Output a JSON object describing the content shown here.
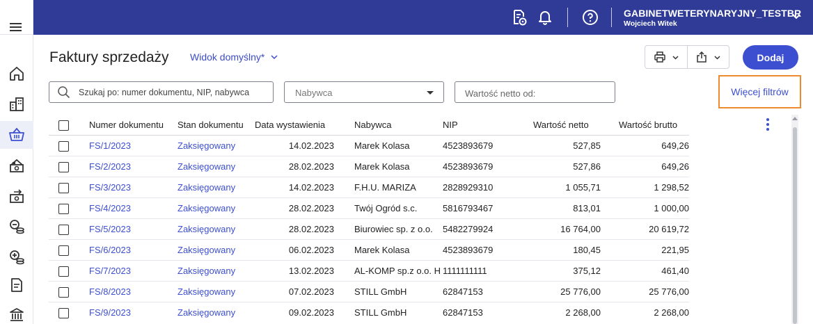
{
  "header": {
    "company": "GABINETWETERYNARYJNY_TESTBR",
    "user": "Wojciech Witek"
  },
  "page": {
    "title": "Faktury sprzedaży",
    "view_label": "Widok domyślny*",
    "add_label": "Dodaj"
  },
  "filters": {
    "search_placeholder": "Szukaj po: numer dokumentu, NIP, nabywca",
    "buyer_placeholder": "Nabywca",
    "net_placeholder": "Wartość netto od:",
    "more_filters_label": "Więcej filtrów"
  },
  "table": {
    "columns": [
      "Numer dokumentu",
      "Stan dokumentu",
      "Data wystawienia",
      "Nabywca",
      "NIP",
      "Wartość netto",
      "Wartość brutto"
    ],
    "rows": [
      {
        "number": "FS/1/2023",
        "state": "Zaksięgowany",
        "date": "14.02.2023",
        "buyer": "Marek Kolasa",
        "nip": "4523893679",
        "net": "527,85",
        "gross": "649,26"
      },
      {
        "number": "FS/2/2023",
        "state": "Zaksięgowany",
        "date": "28.02.2023",
        "buyer": "Marek Kolasa",
        "nip": "4523893679",
        "net": "527,86",
        "gross": "649,26"
      },
      {
        "number": "FS/3/2023",
        "state": "Zaksięgowany",
        "date": "14.02.2023",
        "buyer": "F.H.U. MARIZA",
        "nip": "2828929310",
        "net": "1 055,71",
        "gross": "1 298,52"
      },
      {
        "number": "FS/4/2023",
        "state": "Zaksięgowany",
        "date": "28.02.2023",
        "buyer": "Twój Ogród s.c.",
        "nip": "5816793467",
        "net": "813,01",
        "gross": "1 000,00"
      },
      {
        "number": "FS/5/2023",
        "state": "Zaksięgowany",
        "date": "28.02.2023",
        "buyer": "Biurowiec sp. z o.o.",
        "nip": "5482279924",
        "net": "16 764,00",
        "gross": "20 619,72"
      },
      {
        "number": "FS/6/2023",
        "state": "Zaksięgowany",
        "date": "06.02.2023",
        "buyer": "Marek Kolasa",
        "nip": "4523893679",
        "net": "180,45",
        "gross": "221,95"
      },
      {
        "number": "FS/7/2023",
        "state": "Zaksięgowany",
        "date": "13.02.2023",
        "buyer": "AL-KOMP sp.z o.o. H",
        "nip": "1111111111",
        "net": "375,12",
        "gross": "461,40"
      },
      {
        "number": "FS/8/2023",
        "state": "Zaksięgowany",
        "date": "07.02.2023",
        "buyer": "STILL GmbH",
        "nip": "62847153",
        "net": "25 776,00",
        "gross": "25 776,00"
      },
      {
        "number": "FS/9/2023",
        "state": "Zaksięgowany",
        "date": "09.02.2023",
        "buyer": "STILL GmbH",
        "nip": "62847153",
        "net": "2 268,00",
        "gross": "2 268,00"
      }
    ]
  },
  "colors": {
    "topbar": "#2f3b96",
    "accent": "#3d4fd1",
    "highlight_border": "#ef8a2e"
  },
  "icons": {
    "topbar": [
      "document-settings-icon",
      "bell-icon",
      "help-icon",
      "chevron-down-icon"
    ],
    "sidebar": [
      "hamburger-icon",
      "home-icon",
      "buildings-icon",
      "basket-icon",
      "cash-register-icon",
      "cash-transfer-icon",
      "coins-minus-icon",
      "coins-plus-icon",
      "document-icon",
      "bank-icon"
    ],
    "toolbar": [
      "printer-icon",
      "export-icon"
    ]
  }
}
